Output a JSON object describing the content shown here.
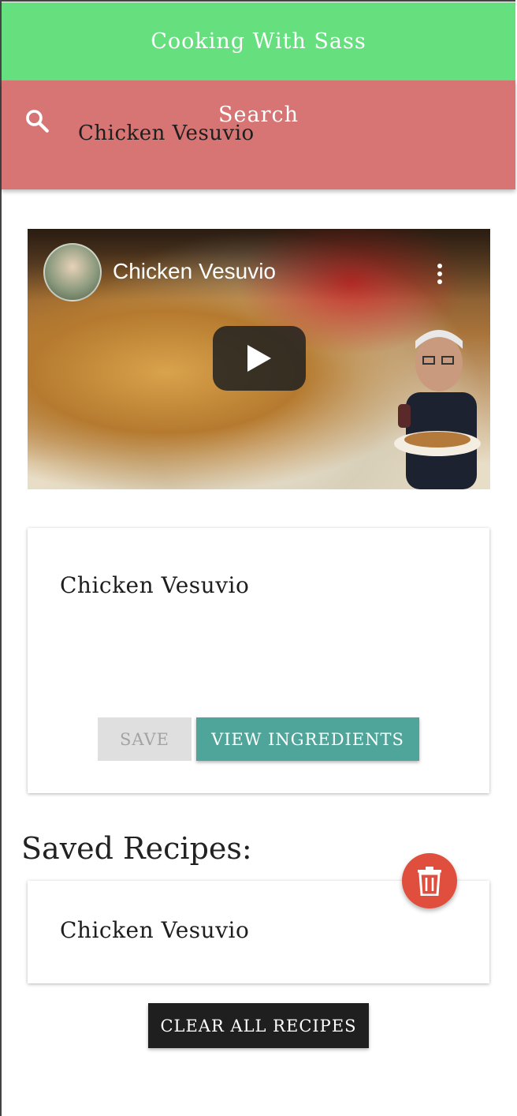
{
  "header": {
    "title": "Cooking With Sass"
  },
  "search": {
    "placeholder": "Search",
    "value": "Chicken Vesuvio"
  },
  "video": {
    "title": "Chicken Vesuvio"
  },
  "recipe": {
    "title": "Chicken Vesuvio",
    "save_label": "SAVE",
    "view_label": "VIEW INGREDIENTS"
  },
  "saved": {
    "heading": "Saved Recipes:",
    "items": [
      {
        "title": "Chicken Vesuvio"
      }
    ],
    "clear_label": "CLEAR ALL RECIPES"
  },
  "colors": {
    "header_bg": "#66e07f",
    "search_bg": "#d67573",
    "view_button": "#50a59a",
    "delete_fab": "#e04e3e",
    "clear_button": "#1f1f1f"
  },
  "icons": {
    "search": "search-icon",
    "play": "play-icon",
    "more": "more-vert-icon",
    "delete": "trash-icon"
  }
}
